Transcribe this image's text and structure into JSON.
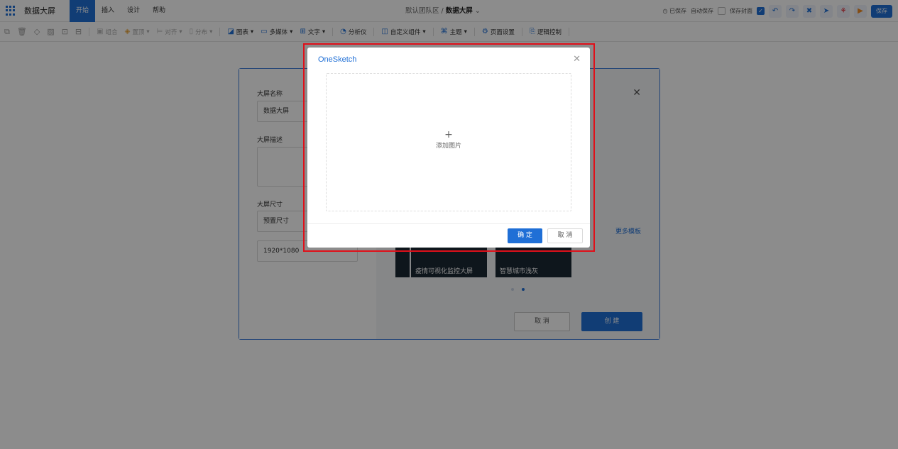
{
  "app": {
    "title": "数据大屏"
  },
  "menu": {
    "tabs": [
      "开始",
      "插入",
      "设计",
      "帮助"
    ]
  },
  "header": {
    "team": "默认团队区",
    "separator": "/",
    "screen_name": "数据大屏"
  },
  "right_tools": {
    "saved_status": "已保存",
    "auto_save": "自动保存",
    "save_cover": "保存封面",
    "save_button": "保存"
  },
  "toolbar": {
    "items": [
      {
        "label": "组合",
        "icon": "group-icon"
      },
      {
        "label": "置顶",
        "icon": "top-icon"
      },
      {
        "label": "对齐",
        "icon": "align-icon"
      },
      {
        "label": "分布",
        "icon": "distribute-icon"
      },
      {
        "label": "图表",
        "icon": "chart-icon"
      },
      {
        "label": "多媒体",
        "icon": "media-icon"
      },
      {
        "label": "文字",
        "icon": "text-icon"
      },
      {
        "label": "分析仪",
        "icon": "analyzer-icon"
      },
      {
        "label": "自定义组件",
        "icon": "custom-component-icon"
      },
      {
        "label": "主题",
        "icon": "theme-icon"
      },
      {
        "label": "页面设置",
        "icon": "page-settings-icon"
      },
      {
        "label": "逻辑控制",
        "icon": "logic-control-icon"
      }
    ]
  },
  "create_dialog": {
    "name_label": "大屏名称",
    "name_value": "数据大屏",
    "desc_label": "大屏描述",
    "size_label": "大屏尺寸",
    "size_preset": "预置尺寸",
    "size_value": "1920*1080",
    "more_templates": "更多模板",
    "templates": [
      "疫情可视化监控大屏",
      "智慧城市浅灰"
    ],
    "cancel": "取 消",
    "create": "创 建"
  },
  "modal": {
    "title": "OneSketch",
    "upload_plus": "+",
    "upload_text": "添加图片",
    "ok": "确 定",
    "cancel": "取 消"
  }
}
